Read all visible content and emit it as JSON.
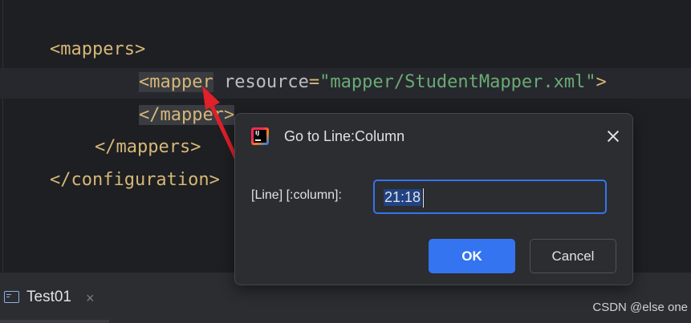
{
  "editor": {
    "lines": {
      "l1": {
        "tag": "<mappers>"
      },
      "l2": {
        "tag_open": "<mapper",
        "attr": " resource",
        "eq": "=",
        "value": "\"mapper/StudentMapper.xml\"",
        "close": ">"
      },
      "l3": {
        "tag": "</mapper>"
      },
      "l4": {
        "tag": "</mappers>"
      },
      "l5": {
        "tag": "</configuration>"
      }
    }
  },
  "dialog": {
    "title": "Go to Line:Column",
    "label": "[Line] [:column]:",
    "input_value": "21:18",
    "ok_label": "OK",
    "cancel_label": "Cancel",
    "icon": "jetbrains-ide-icon"
  },
  "bottom_bar": {
    "tab_label": "Test01",
    "tab_icon": "run-console-icon",
    "close_glyph": "×"
  },
  "watermark": "CSDN @else one",
  "colors": {
    "editor_bg": "#1e1f22",
    "tag": "#d5b778",
    "string": "#6aab73",
    "accent": "#3574f0",
    "arrow": "#e0202a"
  }
}
